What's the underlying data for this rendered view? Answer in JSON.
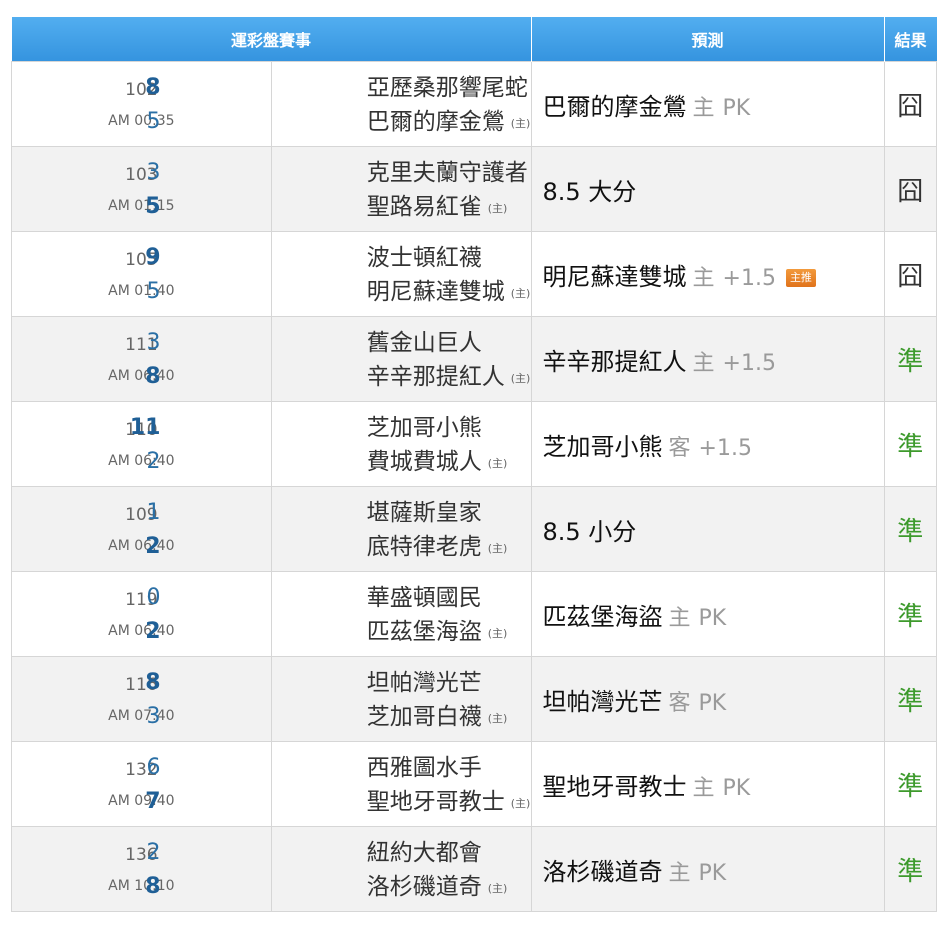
{
  "header": {
    "match_col": "運彩盤賽事",
    "pred_col": "預測",
    "result_col": "結果"
  },
  "home_marker": "(主)",
  "rows": [
    {
      "num": "102",
      "time": "AM 00:35",
      "away": {
        "score": "8",
        "name": "亞歷桑那響尾蛇"
      },
      "home": {
        "score": "5",
        "name": "巴爾的摩金鶯"
      },
      "pred_team": "巴爾的摩金鶯",
      "pred_side": "主",
      "pred_line": "PK",
      "badge": "",
      "result": "囧"
    },
    {
      "num": "103",
      "time": "AM 01:15",
      "away": {
        "score": "3",
        "name": "克里夫蘭守護者"
      },
      "home": {
        "score": "5",
        "name": "聖路易紅雀"
      },
      "pred_team": "8.5 大分",
      "pred_side": "",
      "pred_line": "",
      "badge": "",
      "result": "囧"
    },
    {
      "num": "105",
      "time": "AM 01:40",
      "away": {
        "score": "9",
        "name": "波士頓紅襪"
      },
      "home": {
        "score": "5",
        "name": "明尼蘇達雙城"
      },
      "pred_team": "明尼蘇達雙城",
      "pred_side": "主",
      "pred_line": "+1.5",
      "badge": "主推",
      "result": "囧"
    },
    {
      "num": "111",
      "time": "AM 06:40",
      "away": {
        "score": "3",
        "name": "舊金山巨人"
      },
      "home": {
        "score": "8",
        "name": "辛辛那提紅人"
      },
      "pred_team": "辛辛那提紅人",
      "pred_side": "主",
      "pred_line": "+1.5",
      "badge": "",
      "result": "準"
    },
    {
      "num": "110",
      "time": "AM 06:40",
      "away": {
        "score": "11",
        "name": "芝加哥小熊"
      },
      "home": {
        "score": "2",
        "name": "費城費城人"
      },
      "pred_team": "芝加哥小熊",
      "pred_side": "客",
      "pred_line": "+1.5",
      "badge": "",
      "result": "準"
    },
    {
      "num": "109",
      "time": "AM 06:40",
      "away": {
        "score": "1",
        "name": "堪薩斯皇家"
      },
      "home": {
        "score": "2",
        "name": "底特律老虎"
      },
      "pred_team": "8.5 小分",
      "pred_side": "",
      "pred_line": "",
      "badge": "",
      "result": "準"
    },
    {
      "num": "119",
      "time": "AM 06:40",
      "away": {
        "score": "0",
        "name": "華盛頓國民"
      },
      "home": {
        "score": "2",
        "name": "匹茲堡海盜"
      },
      "pred_team": "匹茲堡海盜",
      "pred_side": "主",
      "pred_line": "PK",
      "badge": "",
      "result": "準"
    },
    {
      "num": "116",
      "time": "AM 07:40",
      "away": {
        "score": "8",
        "name": "坦帕灣光芒"
      },
      "home": {
        "score": "3",
        "name": "芝加哥白襪"
      },
      "pred_team": "坦帕灣光芒",
      "pred_side": "客",
      "pred_line": "PK",
      "badge": "",
      "result": "準"
    },
    {
      "num": "132",
      "time": "AM 09:40",
      "away": {
        "score": "6",
        "name": "西雅圖水手"
      },
      "home": {
        "score": "7",
        "name": "聖地牙哥教士"
      },
      "pred_team": "聖地牙哥教士",
      "pred_side": "主",
      "pred_line": "PK",
      "badge": "",
      "result": "準"
    },
    {
      "num": "136",
      "time": "AM 10:10",
      "away": {
        "score": "2",
        "name": "紐約大都會"
      },
      "home": {
        "score": "8",
        "name": "洛杉磯道奇"
      },
      "pred_team": "洛杉磯道奇",
      "pred_side": "主",
      "pred_line": "PK",
      "badge": "",
      "result": "準"
    }
  ],
  "colors": {
    "header": "#3d9ee6",
    "win_score": "#1f5f96",
    "hit": "#3d9a2c",
    "badge": "#e8822a"
  }
}
